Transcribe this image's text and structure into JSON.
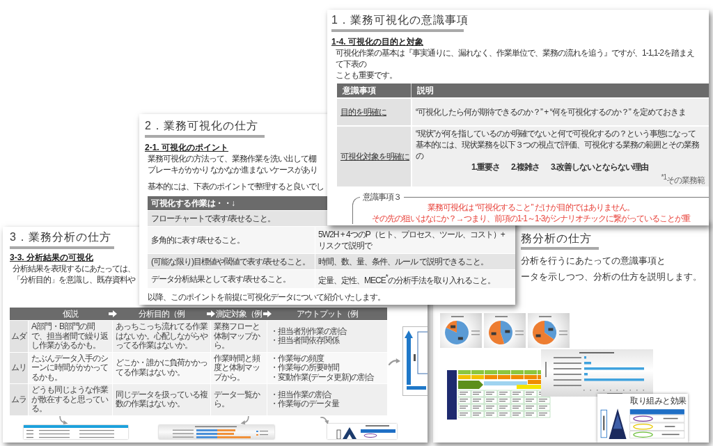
{
  "awareness_page": {
    "title": "1．業務可視化の意識事項",
    "section": "1-4. 可視化の目的と対象",
    "intro_lines": [
      "可視化作業の基本は『事実通りに、漏れなく、作業単位で、業務の流れを追う』ですが、1-1,1-2を踏まえて下表の",
      "ことも重要です。"
    ],
    "table": {
      "columns": [
        "意識事項",
        "説明"
      ],
      "rows": [
        {
          "item": "目的を明確に",
          "lines": [
            "“可視化したら何が期待できるのか？” + “何を可視化するのか？” を定めておきま"
          ]
        },
        {
          "item": "可視化対象を明確に",
          "lines": [
            "“現状”が何を指しているのか明確でないと何で可視化するの？という事態になって",
            "基本的には、現状業務を以下３つの視点で評価、可視化する業務の範囲とその業務の"
          ],
          "viewpoints": [
            "1.重要さ",
            "2.複雑さ",
            "3.改善しないとならない理由"
          ],
          "footnote": "$^{*1}$その業務範"
        }
      ]
    },
    "callout": {
      "legend": "意識事項３",
      "lines": [
        "業務可視化は “可視化すること” だけが目的ではありません。",
        "その先の狙いはなにか？→つまり、前項の1-1～1-3がシナリオチックに繋がっていることが重"
      ]
    }
  },
  "visualization_method_page": {
    "title": "2．業務可視化の仕方",
    "section": "2-1. 可視化のポイント",
    "intro_lines": [
      "業務可視化の方法って、業務作業を洗い出して棚",
      "ブレーキがかかり なかなか進まないケースがあり"
    ],
    "lead": "基本的には、下表のポイントで整理すると良いでし",
    "table": {
      "column": "可視化する作業は・・↓",
      "rows": [
        {
          "point": "フローチャートで表す/表せること。"
        },
        {
          "point": "多角的に表す/表せること。",
          "detail": "5W2H + 4つのP（ヒト、プロセス、ツール、コスト）+ リスクで説明で"
        },
        {
          "point": "(可能な限り)目標値や閾値で表す/表せること。",
          "detail": "時間、数、量、条件、ルール で説明できること。"
        },
        {
          "point": "データ分析結果として表す/表せること。",
          "detail": "定量、定性、MECE$^{*}$の分析手法を取り入れること。"
        }
      ]
    },
    "closing": "以降、このポイントを前提に可視化データについて紹介いたします。"
  },
  "analysis_page": {
    "title": "3．業務分析の仕方",
    "section": "3-3. 分析結果の可視化",
    "intro_lines": [
      "分析結果を表現するにあたっては、",
      "「分析目的」を意識し、既存資料や"
    ],
    "table": {
      "columns": [
        "仮説",
        "分析目的（例",
        "測定対象（例",
        "アウトプット（例"
      ],
      "rows": [
        {
          "label": "ムダ",
          "cells": [
            "A部門・B部門の間で、担当者間で繰り返し作業があるかも。",
            "あっちこっち流れてる作業はないか。心配しながらやってる作業はないか。",
            "業務フローと体制マップから。"
          ],
          "outputs": [
            "・担当者別作業の割合",
            "・担当者間依存関係"
          ]
        },
        {
          "label": "ムリ",
          "cells": [
            "たぶんデータ入手のシーンに時間がかかってるかも。",
            "どこか・誰かに負荷かかってる作業はないか。",
            "作業時間と頻度と体制マップから。"
          ],
          "outputs": [
            "・作業毎の頻度",
            "・作業毎の所要時間",
            "・変動作業(データ更新)の割合"
          ]
        },
        {
          "label": "ムラ",
          "cells": [
            "どうも同じような作業が散在すると思っている。",
            "同じデータを扱っている複数の作業はないか。",
            "データ一覧から。"
          ],
          "outputs": [
            "・担当作業の割合",
            "・作業毎のデータ量"
          ]
        }
      ]
    }
  },
  "analysis_intro_page": {
    "title": "務分析の仕方",
    "intro_lines": [
      "分析を行うにあたっての意識事項と",
      "ータを示しつつ、分析の仕方を説明します。"
    ],
    "thumbnail_title": "取り組みと効果"
  }
}
